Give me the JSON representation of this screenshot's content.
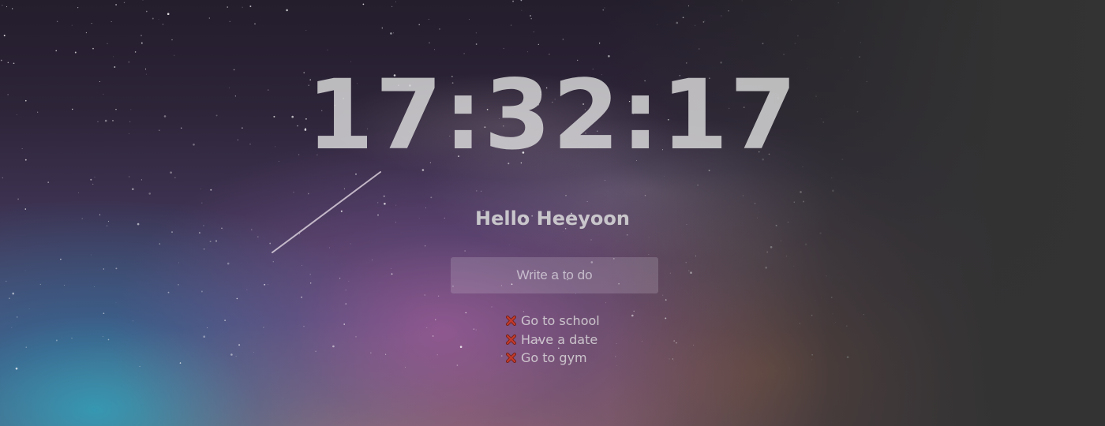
{
  "clock": {
    "time": "17:32:17"
  },
  "greeting": {
    "text": "Hello Heeyoon"
  },
  "todo_form": {
    "placeholder": "Write a to do",
    "value": ""
  },
  "todos": [
    {
      "text": "Go to school",
      "delete_icon": "cross-mark-icon"
    },
    {
      "text": "Have a date",
      "delete_icon": "cross-mark-icon"
    },
    {
      "text": "Go to gym",
      "delete_icon": "cross-mark-icon"
    }
  ],
  "colors": {
    "delete_icon": "#c0392b",
    "delete_icon_dark": "#6b1f17",
    "right_fade": "#333333"
  }
}
